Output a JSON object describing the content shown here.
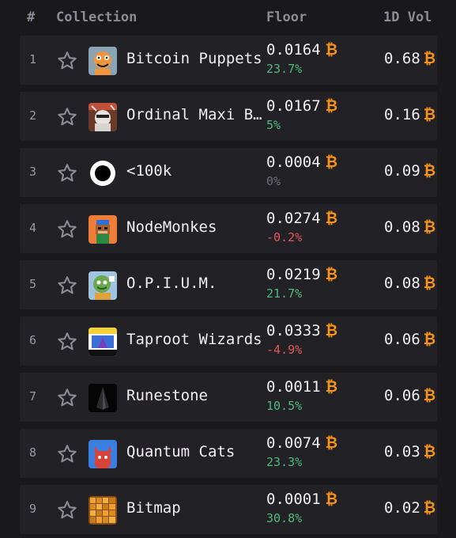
{
  "header": {
    "rank": "#",
    "collection": "Collection",
    "floor": "Floor",
    "volume": "1D Vol"
  },
  "currency_symbol": "₿",
  "colors": {
    "background": "#19181b",
    "row_background": "#222126",
    "positive": "#4fbb7b",
    "negative": "#e25757",
    "neutral": "#6c6a72",
    "bitcoin": "#f7931a"
  },
  "rows": [
    {
      "rank": "1",
      "name": "Bitcoin Puppets",
      "floor": "0.0164",
      "change": "23.7%",
      "trend": "pos",
      "volume": "0.68",
      "thumb_icon": "bitcoin-puppets-thumbnail"
    },
    {
      "rank": "2",
      "name": "Ordinal Maxi Biz",
      "floor": "0.0167",
      "change": "5%",
      "trend": "pos",
      "volume": "0.16",
      "thumb_icon": "ordinal-maxi-biz-thumbnail"
    },
    {
      "rank": "3",
      "name": "<100k",
      "floor": "0.0004",
      "change": "0%",
      "trend": "zero",
      "volume": "0.09",
      "thumb_icon": "sub-100k-thumbnail"
    },
    {
      "rank": "4",
      "name": "NodeMonkes",
      "floor": "0.0274",
      "change": "-0.2%",
      "trend": "neg",
      "volume": "0.08",
      "thumb_icon": "nodemonkes-thumbnail"
    },
    {
      "rank": "5",
      "name": "O.P.I.U.M.",
      "floor": "0.0219",
      "change": "21.7%",
      "trend": "pos",
      "volume": "0.08",
      "thumb_icon": "opium-thumbnail"
    },
    {
      "rank": "6",
      "name": "Taproot Wizards",
      "floor": "0.0333",
      "change": "-4.9%",
      "trend": "neg",
      "volume": "0.06",
      "thumb_icon": "taproot-wizards-thumbnail"
    },
    {
      "rank": "7",
      "name": "Runestone",
      "floor": "0.0011",
      "change": "10.5%",
      "trend": "pos",
      "volume": "0.06",
      "thumb_icon": "runestone-thumbnail"
    },
    {
      "rank": "8",
      "name": "Quantum Cats",
      "floor": "0.0074",
      "change": "23.3%",
      "trend": "pos",
      "volume": "0.03",
      "thumb_icon": "quantum-cats-thumbnail"
    },
    {
      "rank": "9",
      "name": "Bitmap",
      "floor": "0.0001",
      "change": "30.8%",
      "trend": "pos",
      "volume": "0.02",
      "thumb_icon": "bitmap-thumbnail"
    }
  ]
}
